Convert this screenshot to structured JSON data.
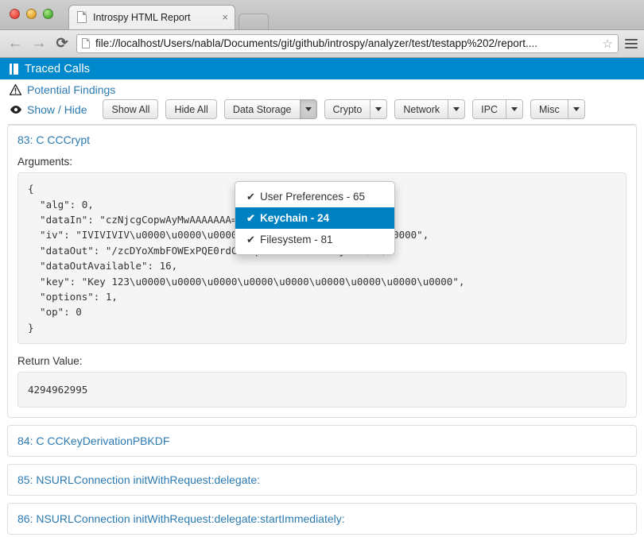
{
  "browser": {
    "tab_title": "Introspy HTML Report",
    "tab_close_label": "×",
    "back_label": "←",
    "forward_label": "→",
    "reload_label": "⟳",
    "url": "file://localhost/Users/nabla/Documents/git/github/introspy/analyzer/test/testapp%202/report....",
    "star_label": "☆"
  },
  "page": {
    "header_title": "Traced Calls",
    "findings_link": "Potential Findings",
    "showhide_link": "Show / Hide",
    "accent_color": "#0088cc",
    "link_color": "#2a7ab0",
    "buttons": [
      {
        "label": "Show All",
        "split": false
      },
      {
        "label": "Hide All",
        "split": false
      },
      {
        "label": "Data Storage",
        "split": true,
        "active": true
      },
      {
        "label": "Crypto",
        "split": true,
        "active": false
      },
      {
        "label": "Network",
        "split": true,
        "active": false
      },
      {
        "label": "IPC",
        "split": true,
        "active": false
      },
      {
        "label": "Misc",
        "split": true,
        "active": false
      }
    ],
    "dropdown": {
      "open_for": "Data Storage",
      "items": [
        {
          "label": "User Preferences - 65",
          "checked": true,
          "selected": false
        },
        {
          "label": "Keychain - 24",
          "checked": true,
          "selected": true
        },
        {
          "label": "Filesystem - 81",
          "checked": true,
          "selected": false
        }
      ],
      "check_glyph": "✔"
    },
    "calls": [
      {
        "title": "83: C CCCrypt",
        "expanded": true,
        "arguments_label": "Arguments:",
        "arguments": "{\n  \"alg\": 0,\n  \"dataIn\": \"czNjcgCopwAyMwAAAAAAA==\",\n  \"iv\": \"IVIVIVIV\\u0000\\u0000\\u0000\\u0000\\u0000\\u0000\\u0000\\u0000\",\n  \"dataOut\": \"/zcDYoXmbFOWExPQE0rdCwC+pwDT+ZlYmHEAANjWYDQ=\",\n  \"dataOutAvailable\": 16,\n  \"key\": \"Key 123\\u0000\\u0000\\u0000\\u0000\\u0000\\u0000\\u0000\\u0000\\u0000\",\n  \"options\": 1,\n  \"op\": 0\n}",
        "return_label": "Return Value:",
        "return_value": "4294962995"
      },
      {
        "title": "84: C CCKeyDerivationPBKDF",
        "expanded": false
      },
      {
        "title": "85: NSURLConnection initWithRequest:delegate:",
        "expanded": false
      },
      {
        "title": "86: NSURLConnection initWithRequest:delegate:startImmediately:",
        "expanded": false
      }
    ]
  }
}
